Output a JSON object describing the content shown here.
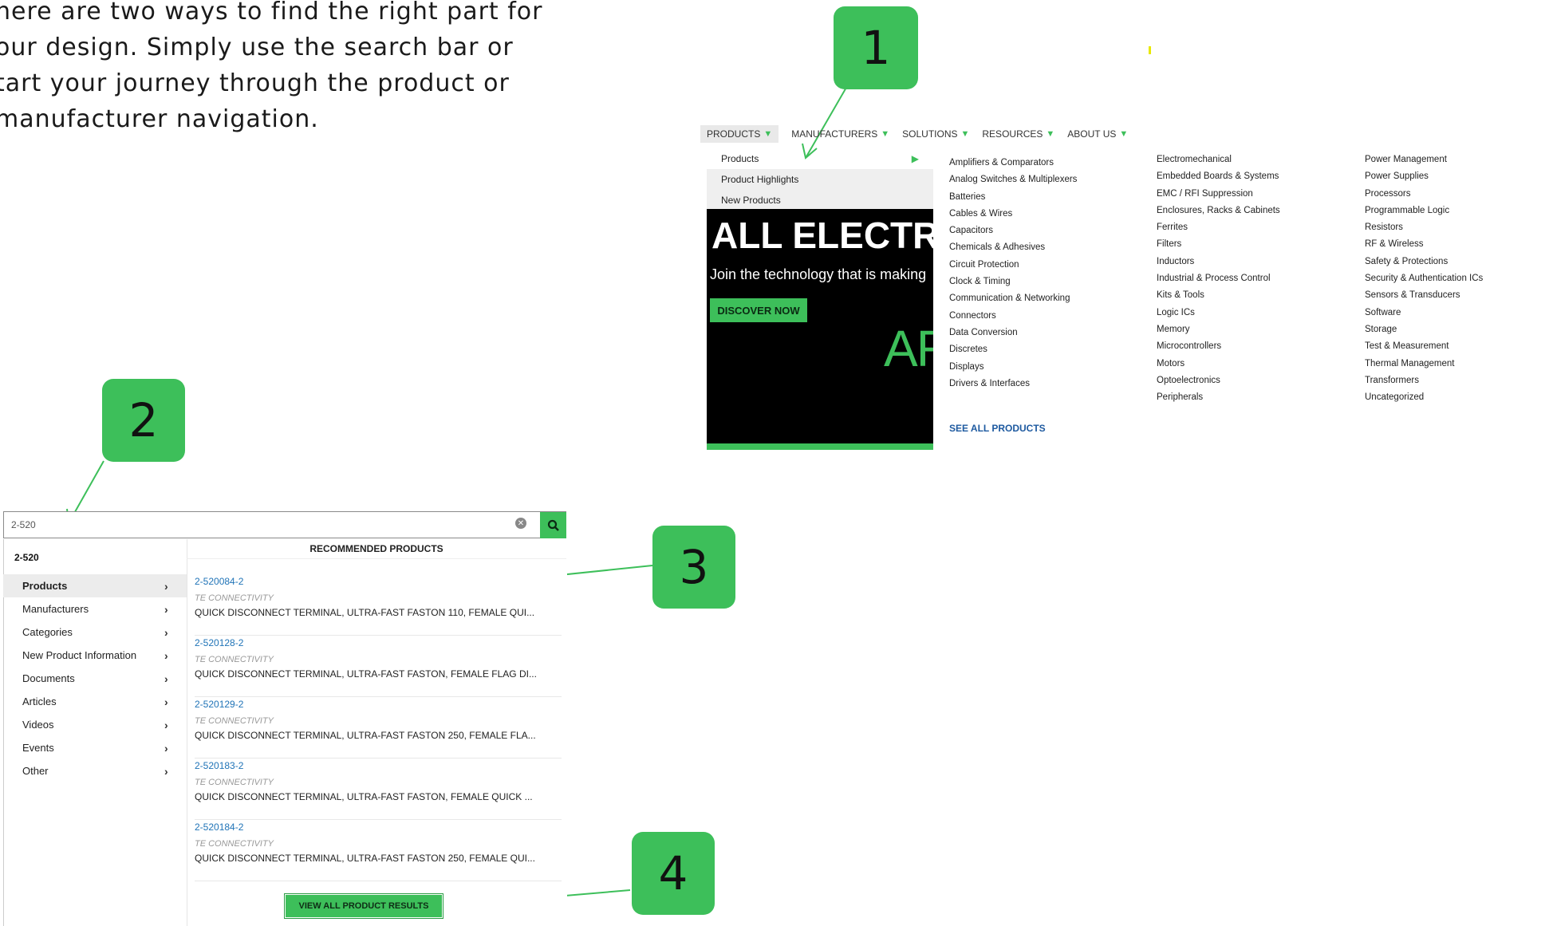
{
  "intro_text": "here are two ways to find the right part for\nour design. Simply use the search bar or\ntart your journey through the product or\nmanufacturer navigation.",
  "badges": [
    "1",
    "2",
    "3",
    "4"
  ],
  "nav": {
    "items": [
      "PRODUCTS",
      "MANUFACTURERS",
      "SOLUTIONS",
      "RESOURCES",
      "ABOUT US"
    ]
  },
  "dropdown": {
    "left_items": [
      "Products",
      "Product Highlights",
      "New Products"
    ],
    "columns": [
      [
        "Amplifiers & Comparators",
        "Analog Switches & Multiplexers",
        "Batteries",
        "Cables & Wires",
        "Capacitors",
        "Chemicals & Adhesives",
        "Circuit Protection",
        "Clock & Timing",
        "Communication & Networking",
        "Connectors",
        "Data Conversion",
        "Discretes",
        "Displays",
        "Drivers & Interfaces"
      ],
      [
        "Electromechanical",
        "Embedded Boards & Systems",
        "EMC / RFI Suppression",
        "Enclosures, Racks & Cabinets",
        "Ferrites",
        "Filters",
        "Inductors",
        "Industrial & Process Control",
        "Kits & Tools",
        "Logic ICs",
        "Memory",
        "Microcontrollers",
        "Motors",
        "Optoelectronics",
        "Peripherals"
      ],
      [
        "Power Management",
        "Power Supplies",
        "Processors",
        "Programmable Logic",
        "Resistors",
        "RF & Wireless",
        "Safety & Protections",
        "Security & Authentication ICs",
        "Sensors & Transducers",
        "Software",
        "Storage",
        "Test & Measurement",
        "Thermal Management",
        "Transformers",
        "Uncategorized"
      ]
    ],
    "see_all": "SEE ALL PRODUCTS"
  },
  "hero": {
    "title": "ALL ELECTRIC",
    "subtitle": "Join the technology that is making",
    "button": "DISCOVER NOW",
    "partial": "ARI"
  },
  "search": {
    "value": "2-520",
    "query_label": "2-520",
    "categories": [
      "Products",
      "Manufacturers",
      "Categories",
      "New Product Information",
      "Documents",
      "Articles",
      "Videos",
      "Events",
      "Other"
    ],
    "recommended_heading": "RECOMMENDED PRODUCTS",
    "results": [
      {
        "pn": "2-520084-2",
        "mfr": "TE CONNECTIVITY",
        "desc": "QUICK DISCONNECT TERMINAL, ULTRA-FAST FASTON 110, FEMALE QUI..."
      },
      {
        "pn": "2-520128-2",
        "mfr": "TE CONNECTIVITY",
        "desc": "QUICK DISCONNECT TERMINAL, ULTRA-FAST FASTON, FEMALE FLAG DI..."
      },
      {
        "pn": "2-520129-2",
        "mfr": "TE CONNECTIVITY",
        "desc": "QUICK DISCONNECT TERMINAL, ULTRA-FAST FASTON 250, FEMALE FLA..."
      },
      {
        "pn": "2-520183-2",
        "mfr": "TE CONNECTIVITY",
        "desc": "QUICK DISCONNECT TERMINAL, ULTRA-FAST FASTON, FEMALE QUICK ..."
      },
      {
        "pn": "2-520184-2",
        "mfr": "TE CONNECTIVITY",
        "desc": "QUICK DISCONNECT TERMINAL, ULTRA-FAST FASTON 250, FEMALE QUI..."
      }
    ],
    "view_all": "VIEW ALL PRODUCT RESULTS"
  },
  "colors": {
    "accent": "#3dbf5a",
    "link": "#1f73b7",
    "hero_bg": "#000000"
  }
}
